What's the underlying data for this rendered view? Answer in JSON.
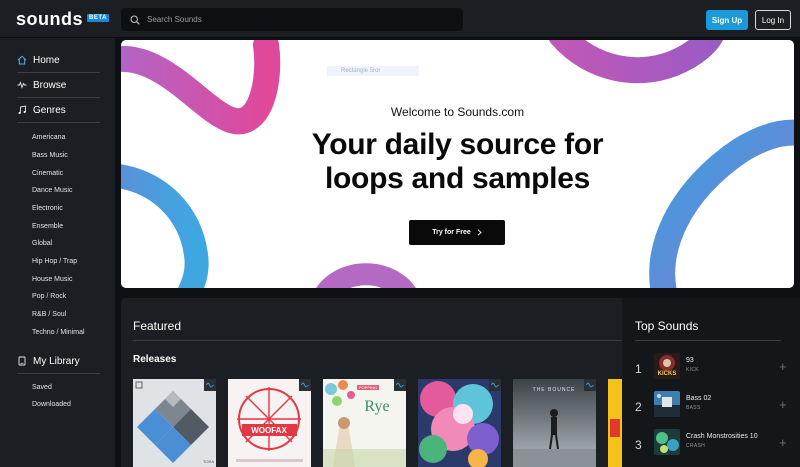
{
  "brand": {
    "logo_text": "sounds",
    "badge": "BETA",
    "accent": "#1a9ad8"
  },
  "header": {
    "search_placeholder": "Search Sounds",
    "signup_label": "Sign Up",
    "login_label": "Log In"
  },
  "sidebar": {
    "nav": [
      {
        "label": "Home",
        "icon": "home-icon"
      },
      {
        "label": "Browse",
        "icon": "waveform-icon"
      },
      {
        "label": "Genres",
        "icon": "music-note-icon"
      }
    ],
    "genres": [
      "Americana",
      "Bass Music",
      "Cinematic",
      "Dance Music",
      "Electronic",
      "Ensemble",
      "Global",
      "Hip Hop / Trap",
      "House Music",
      "Pop / Rock",
      "R&B / Soul",
      "Techno / Minimal"
    ],
    "library": {
      "label": "My Library",
      "icon": "library-icon",
      "items": [
        "Saved",
        "Downloaded"
      ]
    }
  },
  "hero": {
    "tag": "Rectangle 5ror",
    "welcome": "Welcome to Sounds.com",
    "title_line1": "Your daily source for",
    "title_line2": "loops and samples",
    "cta": "Try for Free"
  },
  "featured": {
    "title": "Featured",
    "releases_title": "Releases",
    "albums": [
      {
        "art": "tora",
        "cover_text": "TORA"
      },
      {
        "art": "woofax",
        "cover_text": "WOOFAX"
      },
      {
        "art": "rye",
        "cover_text": "Rye",
        "cover_subtext": "POPPING"
      },
      {
        "art": "floral",
        "cover_text": ""
      },
      {
        "art": "bounce",
        "cover_text": "THE BOUNCE"
      },
      {
        "art": "yellow",
        "cover_text": ""
      }
    ]
  },
  "top_sounds": {
    "title": "Top Sounds",
    "items": [
      {
        "rank": "1",
        "name": "93",
        "category": "KICK",
        "thumb_text": "KICKS"
      },
      {
        "rank": "2",
        "name": "Bass 02",
        "category": "BASS",
        "thumb_text": ""
      },
      {
        "rank": "3",
        "name": "Crash Monstrosities 10",
        "category": "CRASH",
        "thumb_text": ""
      }
    ]
  }
}
